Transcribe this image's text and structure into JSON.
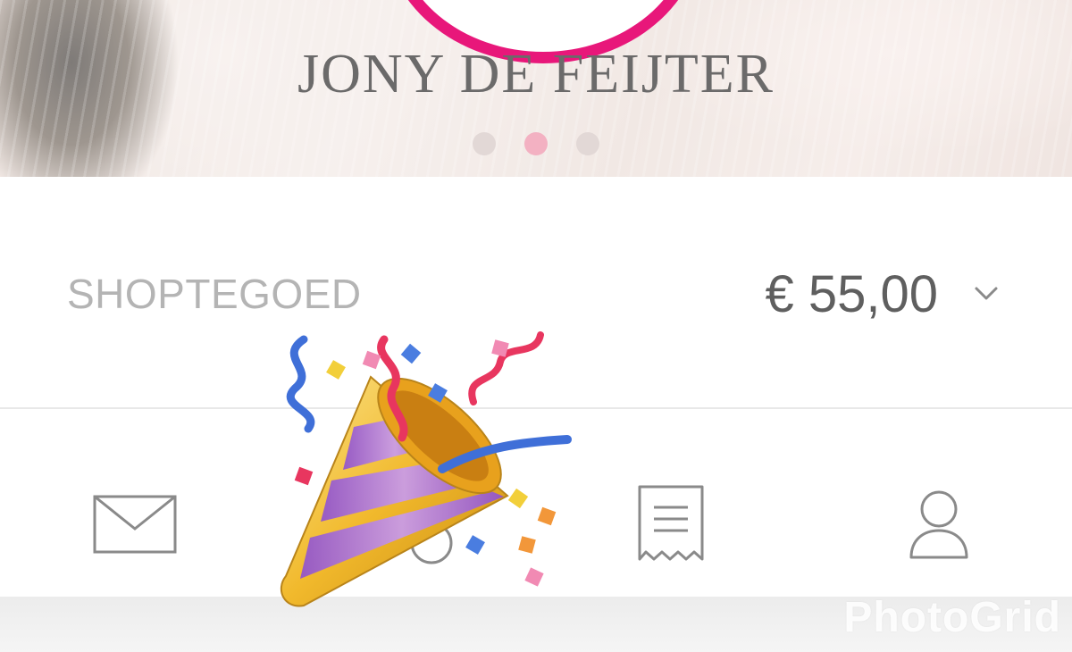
{
  "header": {
    "title": "JONY DE FEIJTER",
    "carousel": {
      "count": 3,
      "active_index": 1
    }
  },
  "credit": {
    "label": "SHOPTEGOED",
    "amount": "€ 55,00"
  },
  "nav": {
    "items": [
      {
        "icon": "mail-icon"
      },
      {
        "icon": "home-icon"
      },
      {
        "icon": "receipt-icon"
      },
      {
        "icon": "user-icon"
      }
    ]
  },
  "overlay": {
    "icon": "party-popper-icon"
  },
  "watermark": {
    "text": "PhotoGrid"
  },
  "colors": {
    "accent_pink": "#e8177a",
    "dot_active": "#f3b1c2",
    "dot_inactive": "#e2d8d6",
    "icon_gray": "#8a8a8a"
  }
}
